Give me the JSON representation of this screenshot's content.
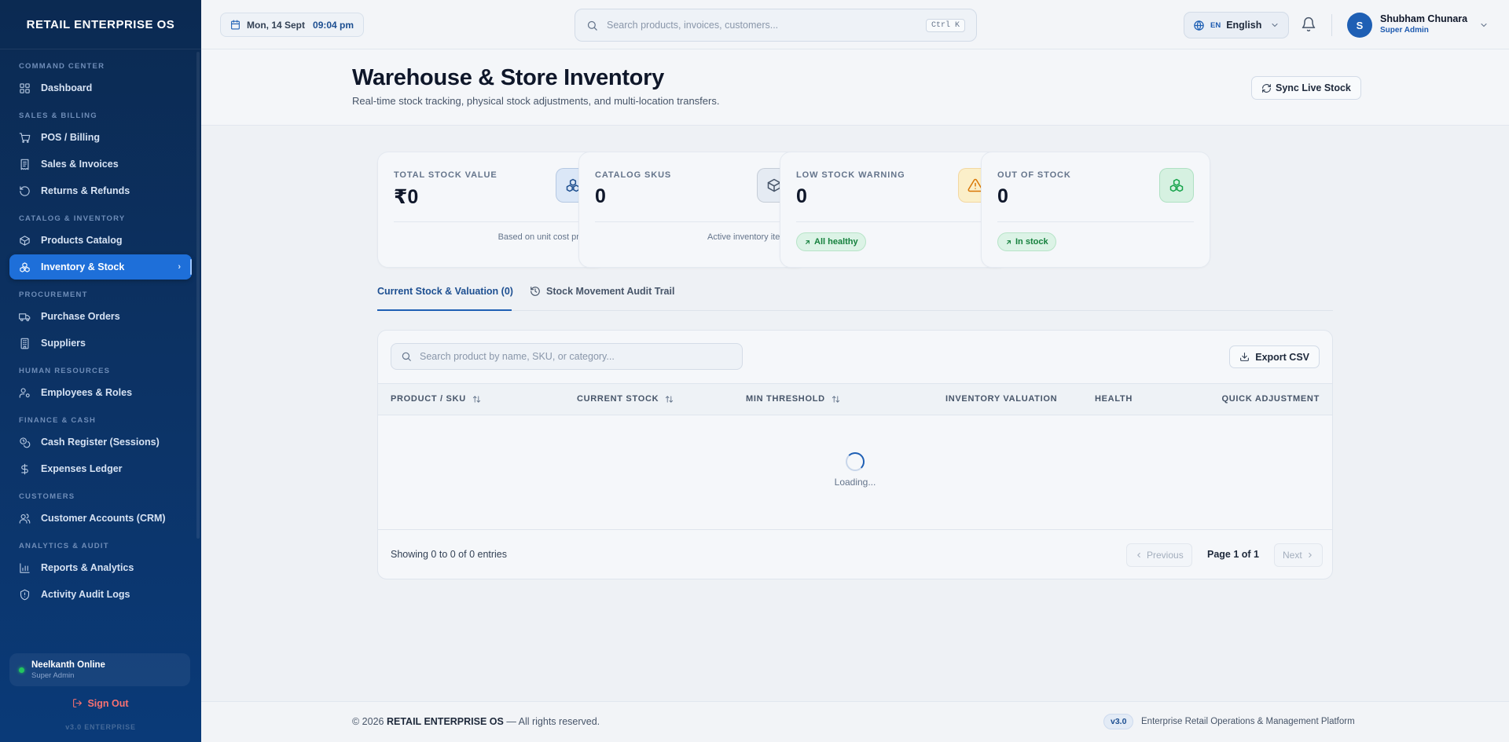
{
  "app": {
    "brand": "RETAIL ENTERPRISE OS"
  },
  "sidebar": {
    "sections": [
      {
        "title": "COMMAND CENTER",
        "items": [
          {
            "label": "Dashboard",
            "icon": "grid-icon"
          }
        ]
      },
      {
        "title": "SALES & BILLING",
        "items": [
          {
            "label": "POS / Billing",
            "icon": "cart-icon"
          },
          {
            "label": "Sales & Invoices",
            "icon": "receipt-icon"
          },
          {
            "label": "Returns & Refunds",
            "icon": "undo-icon"
          }
        ]
      },
      {
        "title": "CATALOG & INVENTORY",
        "items": [
          {
            "label": "Products Catalog",
            "icon": "box-icon"
          },
          {
            "label": "Inventory & Stock",
            "icon": "boxes-icon",
            "active": true
          }
        ]
      },
      {
        "title": "PROCUREMENT",
        "items": [
          {
            "label": "Purchase Orders",
            "icon": "truck-icon"
          },
          {
            "label": "Suppliers",
            "icon": "building-icon"
          }
        ]
      },
      {
        "title": "HUMAN RESOURCES",
        "items": [
          {
            "label": "Employees & Roles",
            "icon": "user-cog-icon"
          }
        ]
      },
      {
        "title": "FINANCE & CASH",
        "items": [
          {
            "label": "Cash Register (Sessions)",
            "icon": "coins-icon"
          },
          {
            "label": "Expenses Ledger",
            "icon": "dollar-icon"
          }
        ]
      },
      {
        "title": "CUSTOMERS",
        "items": [
          {
            "label": "Customer Accounts (CRM)",
            "icon": "users-icon"
          }
        ]
      },
      {
        "title": "ANALYTICS & AUDIT",
        "items": [
          {
            "label": "Reports & Analytics",
            "icon": "bar-chart-icon"
          },
          {
            "label": "Activity Audit Logs",
            "icon": "shield-icon"
          }
        ]
      }
    ],
    "user": {
      "name": "Neelkanth Online",
      "role": "Super Admin",
      "status_color": "#22c55e"
    },
    "sign_out": "Sign Out",
    "version": "v3.0 ENTERPRISE"
  },
  "topbar": {
    "date": "Mon, 14 Sept",
    "time": "09:04 pm",
    "search_placeholder": "Search products, invoices, customers...",
    "shortcut": "Ctrl K",
    "language_code": "EN",
    "language": "English",
    "user_initial": "S",
    "user_name": "Shubham Chunara",
    "user_role": "Super Admin"
  },
  "header": {
    "title": "Warehouse & Store Inventory",
    "subtitle": "Real-time stock tracking, physical stock adjustments, and multi-location transfers.",
    "sync_label": "Sync Live Stock"
  },
  "kpis": [
    {
      "label": "TOTAL STOCK VALUE",
      "value": "₹0",
      "note": "Based on unit cost price",
      "icon": "boxes-icon",
      "icon_bg": "#dbe7f7",
      "icon_color": "#1e4f8f"
    },
    {
      "label": "CATALOG SKUS",
      "value": "0",
      "note": "Active inventory items",
      "icon": "box-icon",
      "icon_bg": "#e5ebf3",
      "icon_color": "#475569"
    },
    {
      "label": "LOW STOCK WARNING",
      "value": "0",
      "badge": "All healthy",
      "icon": "warning-icon",
      "icon_bg": "#fbefc9",
      "icon_color": "#d97706"
    },
    {
      "label": "OUT OF STOCK",
      "value": "0",
      "badge": "In stock",
      "icon": "boxes-icon",
      "icon_bg": "#d6f1e1",
      "icon_color": "#16a34a"
    }
  ],
  "tabs": [
    {
      "label": "Current Stock & Valuation (0)",
      "active": true
    },
    {
      "label": "Stock Movement Audit Trail",
      "icon": "history-icon"
    }
  ],
  "table": {
    "search_placeholder": "Search product by name, SKU, or category...",
    "export_label": "Export CSV",
    "columns": [
      "PRODUCT / SKU",
      "CURRENT STOCK",
      "MIN THRESHOLD",
      "INVENTORY VALUATION",
      "HEALTH",
      "QUICK ADJUSTMENT"
    ],
    "loading_text": "Loading...",
    "showing": "Showing 0 to 0 of 0 entries",
    "prev_label": "Previous",
    "page_info": "Page 1 of 1",
    "next_label": "Next"
  },
  "footer": {
    "copyright_prefix": "© 2026",
    "brand": "RETAIL ENTERPRISE OS",
    "copyright_suffix": "— All rights reserved.",
    "version": "v3.0",
    "tagline": "Enterprise Retail Operations & Management Platform"
  }
}
